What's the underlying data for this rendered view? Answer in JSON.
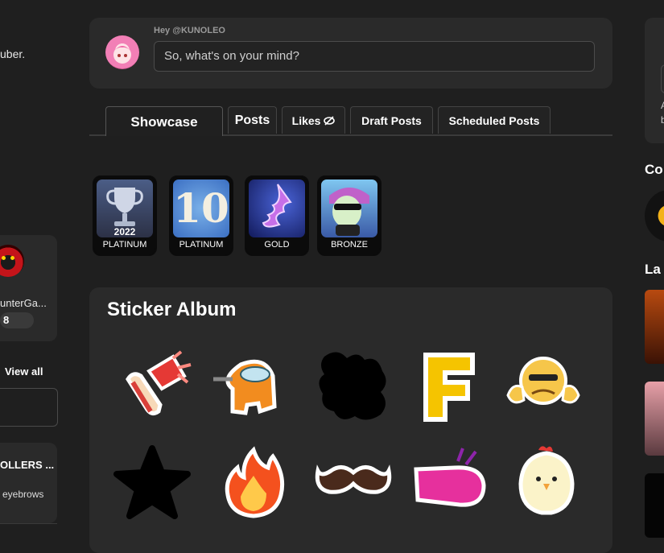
{
  "left": {
    "bio_fragment": "uber.",
    "user_name_fragment": "unterGa...",
    "user_badge_value": "8",
    "view_all_label": "View all",
    "card_title_fragment": "OLLERS ...",
    "card_text_fragment": "eyebrows"
  },
  "composer": {
    "greeting": "Hey @KUNOLEO",
    "placeholder": "So, what's on your mind?"
  },
  "tabs": [
    {
      "label": "Showcase",
      "active": true
    },
    {
      "label": "Posts"
    },
    {
      "label": "Likes"
    },
    {
      "label": "Draft Posts"
    },
    {
      "label": "Scheduled Posts"
    }
  ],
  "showcase": [
    {
      "label": "PLATINUM",
      "year": "2022",
      "icon": "trophy-icon"
    },
    {
      "label": "PLATINUM",
      "number": "10",
      "icon": "ten-anniversary-icon"
    },
    {
      "label": "GOLD",
      "icon": "lightning-tornado-icon"
    },
    {
      "label": "BRONZE",
      "icon": "cool-character-icon"
    }
  ],
  "album": {
    "title": "Sticker Album",
    "stickers": [
      {
        "icon": "megaphone-sticker"
      },
      {
        "icon": "among-us-crewmate-sticker"
      },
      {
        "icon": "locked-silhouette-sticker"
      },
      {
        "icon": "letter-f-sticker",
        "text": "F"
      },
      {
        "icon": "sweating-thumbs-emoji-sticker"
      },
      {
        "icon": "locked-star-sticker"
      },
      {
        "icon": "fire-sticker"
      },
      {
        "icon": "mustache-sticker"
      },
      {
        "icon": "pink-fist-sticker"
      },
      {
        "icon": "chicken-sticker"
      }
    ]
  },
  "right": {
    "heading1_fragment": "Co",
    "heading2_fragment": "La",
    "text_fragment_a": "A",
    "text_fragment_b": "b"
  },
  "colors": {
    "page_bg": "#1f1f1f",
    "card_bg": "#2a2a2a",
    "accent_yellow": "#f5c400"
  }
}
